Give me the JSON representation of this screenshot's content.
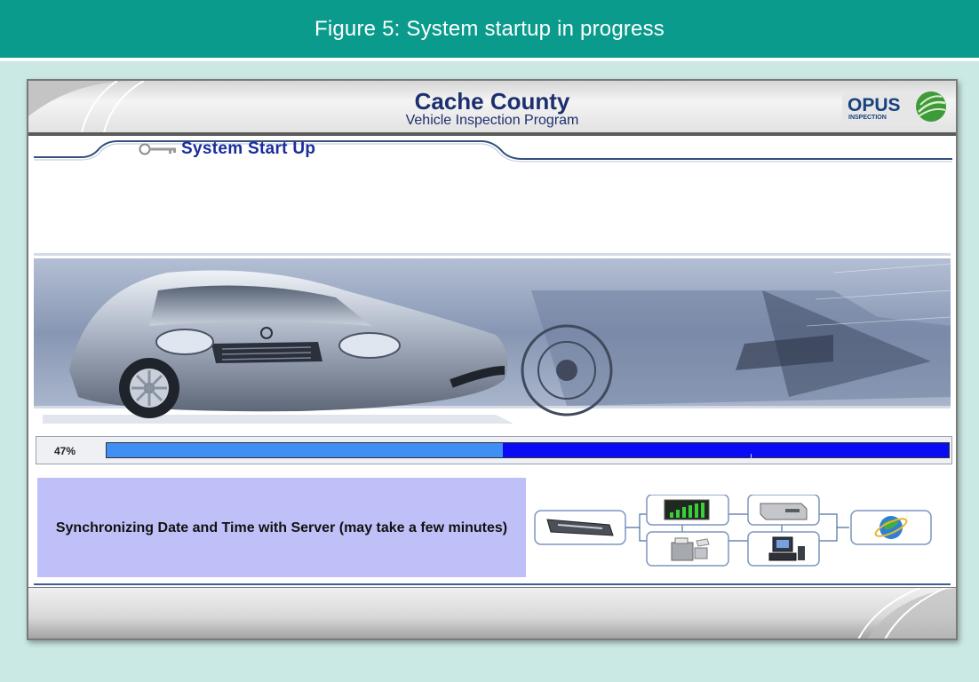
{
  "figure": {
    "caption": "Figure 5: System startup in progress"
  },
  "app": {
    "county": "Cache County",
    "program": "Vehicle Inspection Program",
    "logo": {
      "wordmark": "OPUS",
      "tagline": "INSPECTION"
    }
  },
  "section": {
    "title": "System Start Up",
    "icon": "key-icon"
  },
  "progress": {
    "label": "47%",
    "fraction": 0.47
  },
  "status": {
    "message": "Synchronizing Date and Time with Server (may take a few minutes)"
  },
  "diagram": {
    "devices": [
      "obd-plug-icon",
      "analyzer-display-icon",
      "printer-icon",
      "server-icon",
      "workstation-icon",
      "internet-globe-icon"
    ]
  },
  "colors": {
    "banner": "#0a9b8c",
    "page_background": "#cbe9e4",
    "title_text": "#1d2f6e",
    "progress_fill": "#3f8ff5",
    "progress_track": "#0a0af5",
    "status_background": "#c0c0f9"
  }
}
